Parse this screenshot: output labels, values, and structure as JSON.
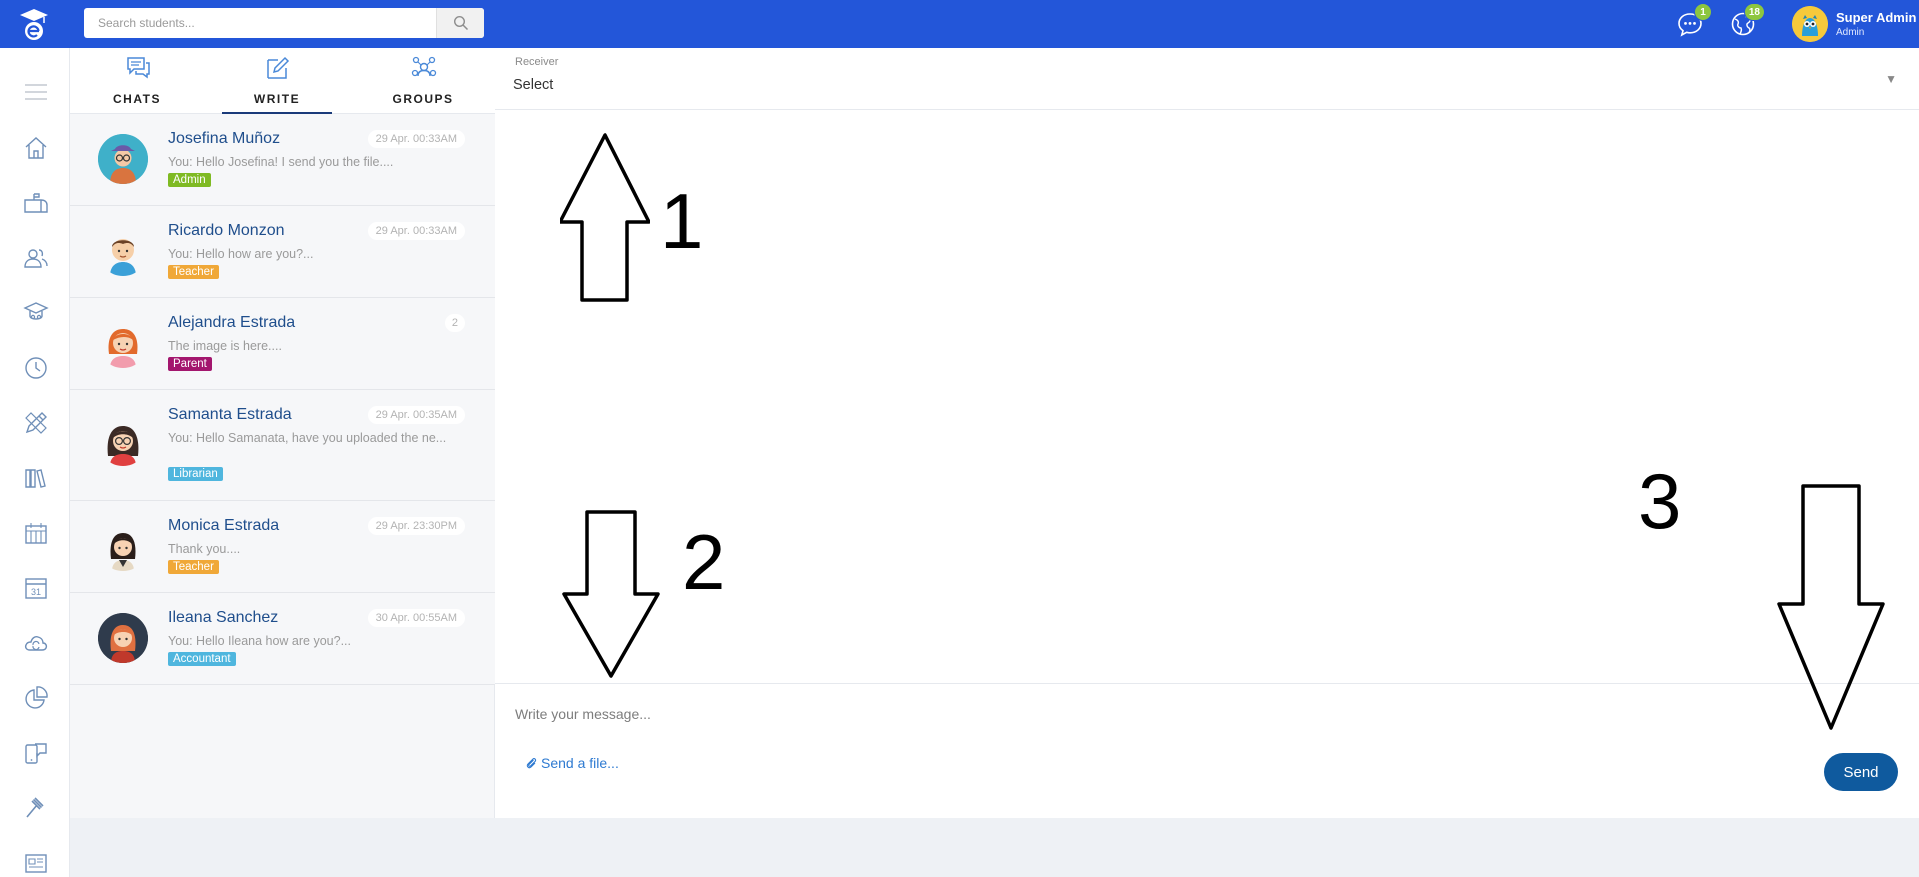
{
  "topbar": {
    "logo_icon": "graduation-e-logo",
    "search_placeholder": "Search students...",
    "messages_badge": "1",
    "notifications_badge": "18",
    "user_name": "Super Admin",
    "user_role": "Admin"
  },
  "sidebar_icons": [
    "menu-icon",
    "home-icon",
    "mailbox-icon",
    "users-icon",
    "graduate-icon",
    "clock-icon",
    "pencil-ruler-icon",
    "library-icon",
    "calendar-grid-icon",
    "calendar-31-icon",
    "cloud-sync-icon",
    "pie-chart-icon",
    "chat-device-icon",
    "gavel-icon",
    "newspaper-icon"
  ],
  "calendar_day": "31",
  "tabs": [
    {
      "label": "CHATS",
      "icon": "chat-bubbles-icon"
    },
    {
      "label": "WRITE",
      "icon": "pencil-write-icon"
    },
    {
      "label": "GROUPS",
      "icon": "group-icon"
    }
  ],
  "chats": [
    {
      "name": "Josefina Muñoz",
      "time": "29 Apr. 00:33AM",
      "preview": "You: Hello Josefina! I send you the file....",
      "role": "Admin",
      "role_color": "#7fba23"
    },
    {
      "name": "Ricardo Monzon",
      "time": "29 Apr. 00:33AM",
      "preview": "You: Hello how are you?...",
      "role": "Teacher",
      "role_color": "#f0a838"
    },
    {
      "name": "Alejandra Estrada",
      "count": "2",
      "preview": "The image is here....",
      "role": "Parent",
      "role_color": "#a3166e"
    },
    {
      "name": "Samanta Estrada",
      "time": "29 Apr. 00:35AM",
      "preview": "You: Hello Samanata, have you uploaded the ne...",
      "role": "Librarian",
      "role_color": "#4fb6de"
    },
    {
      "name": "Monica Estrada",
      "time": "29 Apr. 23:30PM",
      "preview": "Thank you....",
      "role": "Teacher",
      "role_color": "#f0a838"
    },
    {
      "name": "Ileana Sanchez",
      "time": "30 Apr. 00:55AM",
      "preview": "You: Hello Ileana how are you?...",
      "role": "Accountant",
      "role_color": "#4fb6de"
    }
  ],
  "receiver": {
    "label": "Receiver",
    "value": "Select"
  },
  "compose": {
    "placeholder": "Write your message...",
    "send_file_label": "Send a file...",
    "send_label": "Send"
  },
  "annotations": {
    "n1": "1",
    "n2": "2",
    "n3": "3"
  }
}
